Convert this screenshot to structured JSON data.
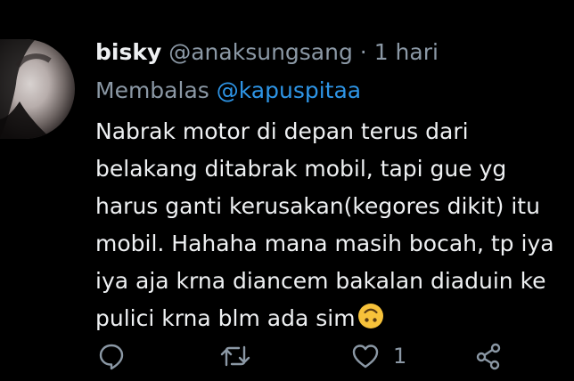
{
  "tweet": {
    "display_name": "bisky",
    "handle": "@anaksungsang",
    "separator": "·",
    "time": "1 hari",
    "reply_prefix": "Membalas",
    "reply_to": "@kapuspitaa",
    "body_lines": [
      "Nabrak motor di depan terus dari",
      "belakang ditabrak mobil, tapi gue yg",
      "harus ganti kerusakan(kegores dikit) itu",
      "mobil. Hahaha mana masih bocah, tp iya",
      "iya aja krna diancem bakalan diaduin ke",
      "pulici krna blm ada sim"
    ],
    "emoji": "upside-down-face-emoji"
  },
  "actions": {
    "reply_icon": "reply-icon",
    "retweet_icon": "retweet-icon",
    "like_icon": "heart-icon",
    "like_count": "1",
    "share_icon": "share-icon"
  },
  "colors": {
    "background": "#000000",
    "text_primary": "#eef0f2",
    "text_secondary": "#8b98a5",
    "link": "#2e95e6",
    "emoji": "#f7c23a"
  }
}
